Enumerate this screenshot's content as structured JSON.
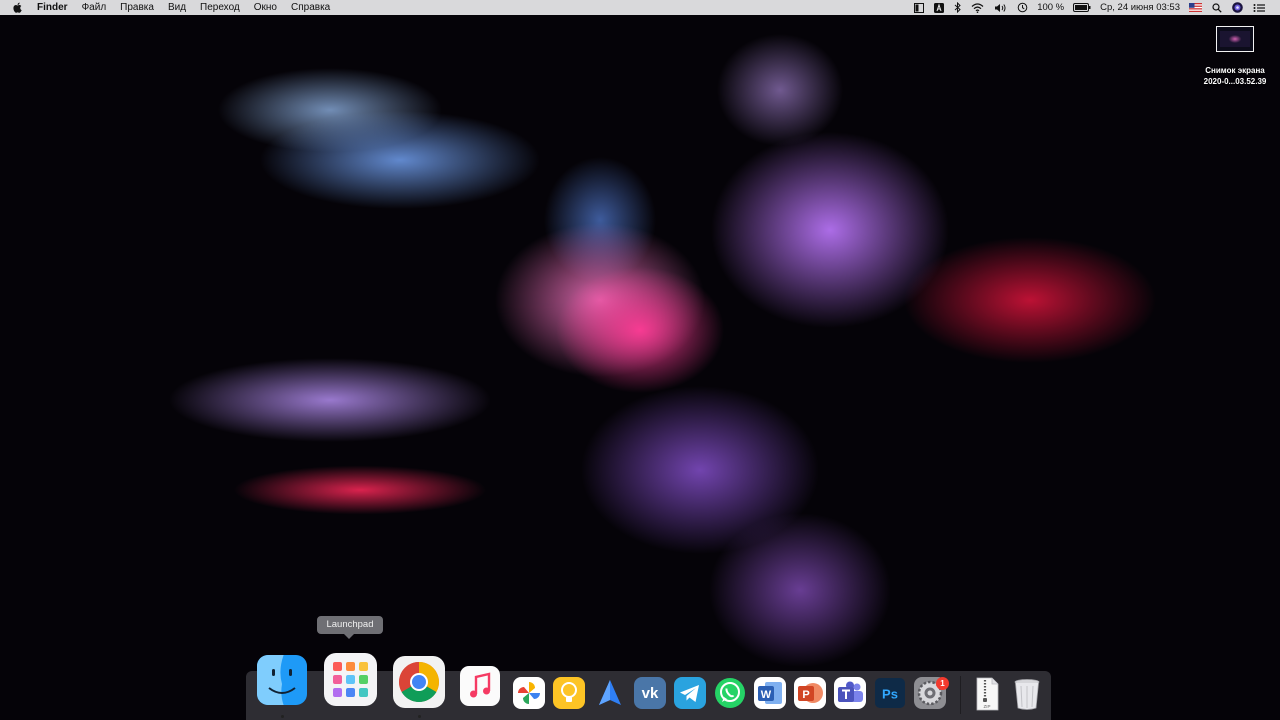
{
  "menubar": {
    "apple_icon": "apple-logo-icon",
    "app_name": "Finder",
    "items": [
      "Файл",
      "Правка",
      "Вид",
      "Переход",
      "Окно",
      "Справка"
    ],
    "status": {
      "battery_percent": "100 %",
      "datetime": "Ср, 24 июня  03:53"
    }
  },
  "desktop": {
    "file": {
      "name_line1": "Снимок экрана",
      "name_line2": "2020-0...03.52.39"
    }
  },
  "tooltip": {
    "text": "Launchpad"
  },
  "dock": {
    "apps": [
      {
        "name": "Finder",
        "icon": "finder-icon",
        "running": true
      },
      {
        "name": "Launchpad",
        "icon": "launchpad-icon",
        "running": false
      },
      {
        "name": "Google Chrome",
        "icon": "chrome-icon",
        "running": true
      },
      {
        "name": "Music",
        "icon": "music-icon",
        "running": false
      },
      {
        "name": "Photos",
        "icon": "photos-icon",
        "running": false
      },
      {
        "name": "Tips",
        "icon": "lightbulb-icon",
        "running": false
      },
      {
        "name": "Navigator",
        "icon": "arrow-icon",
        "running": false
      },
      {
        "name": "VK",
        "icon": "vk-icon",
        "running": false
      },
      {
        "name": "Telegram",
        "icon": "telegram-icon",
        "running": false
      },
      {
        "name": "WhatsApp",
        "icon": "whatsapp-icon",
        "running": false
      },
      {
        "name": "Word",
        "icon": "word-icon",
        "running": false
      },
      {
        "name": "PowerPoint",
        "icon": "powerpoint-icon",
        "running": false
      },
      {
        "name": "Teams",
        "icon": "teams-icon",
        "running": false
      },
      {
        "name": "Photoshop",
        "icon": "photoshop-icon",
        "running": false
      },
      {
        "name": "System Preferences",
        "icon": "gear-icon",
        "running": false,
        "badge": "1"
      },
      {
        "name": "Archive",
        "icon": "zip-file-icon",
        "running": false
      },
      {
        "name": "Trash",
        "icon": "trash-icon",
        "running": false
      }
    ],
    "word_letter": "W",
    "powerpoint_letter": "P",
    "photoshop_letters": "Ps",
    "vk_letters": "vk",
    "zip_label": "ZIP"
  },
  "colors": {
    "menubar_bg": "#ececee",
    "badge": "#f23a2e",
    "word": "#2b5fb4",
    "powerpoint": "#d14524",
    "photoshop": "#0e2a47",
    "whatsapp": "#25d366",
    "telegram": "#2aa3df",
    "vk": "#4a76a8"
  }
}
